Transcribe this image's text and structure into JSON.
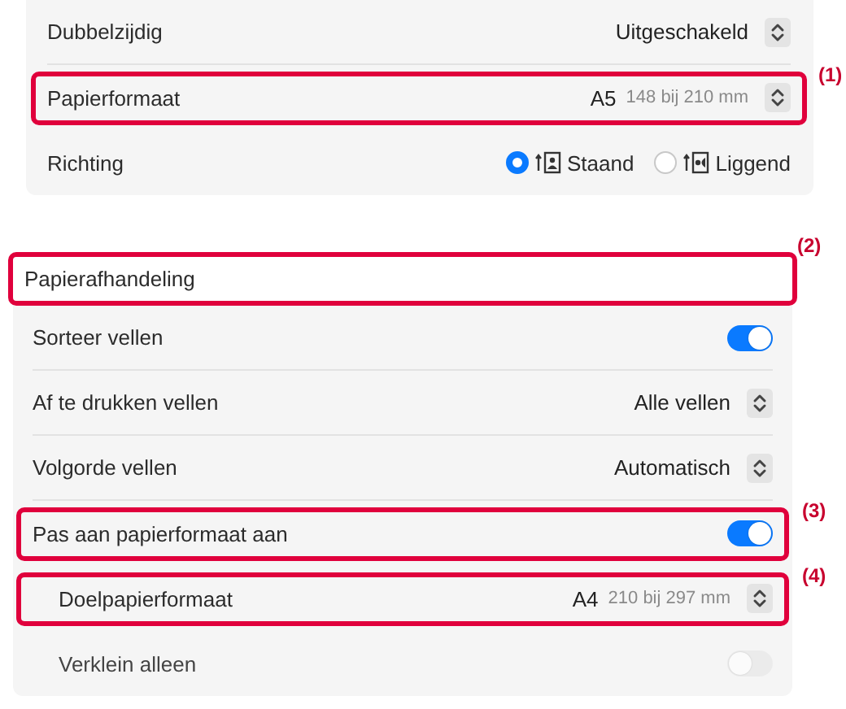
{
  "sections": [
    {
      "rows": [
        {
          "kind": "popup",
          "label": "Dubbelzijdig",
          "value": "Uitgeschakeld"
        },
        {
          "kind": "popup",
          "label": "Papierformaat",
          "value": "A5",
          "detail": "148 bij 210 mm",
          "callout": "(1)"
        },
        {
          "kind": "radio",
          "label": "Richting",
          "options": [
            {
              "label": "Staand",
              "selected": true
            },
            {
              "label": "Liggend",
              "selected": false
            }
          ]
        }
      ]
    },
    {
      "title": "Papierafhandeling",
      "title_callout": "(2)",
      "rows": [
        {
          "kind": "toggle",
          "label": "Sorteer vellen",
          "on": true,
          "disabled": false
        },
        {
          "kind": "popup",
          "label": "Af te drukken vellen",
          "value": "Alle vellen"
        },
        {
          "kind": "popup",
          "label": "Volgorde vellen",
          "value": "Automatisch"
        },
        {
          "kind": "toggle",
          "label": "Pas aan papierformaat aan",
          "on": true,
          "disabled": false,
          "callout": "(3)"
        },
        {
          "kind": "popup",
          "label": "Doelpapierformaat",
          "value": "A4",
          "detail": "210 bij 297 mm",
          "callout": "(4)",
          "indented": true
        },
        {
          "kind": "toggle",
          "label": "Verklein alleen",
          "on": false,
          "disabled": true,
          "indented": true
        }
      ]
    }
  ]
}
